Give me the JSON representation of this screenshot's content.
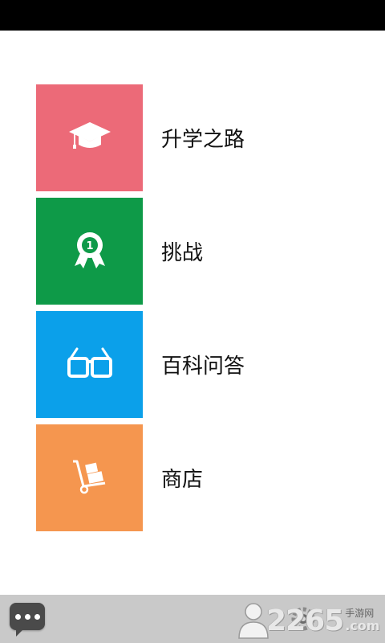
{
  "menu": {
    "items": [
      {
        "label": "升学之路",
        "icon": "graduation-cap-icon",
        "color": "#ec6a78"
      },
      {
        "label": "挑战",
        "icon": "award-badge-icon",
        "color": "#0e9a48",
        "badge_number": "1"
      },
      {
        "label": "百科问答",
        "icon": "glasses-icon",
        "color": "#0ba0ea"
      },
      {
        "label": "商店",
        "icon": "hand-truck-icon",
        "color": "#f5964f"
      }
    ]
  },
  "bottom_bar": {
    "chat_icon": "chat-bubble-icon",
    "avatar_icon": "user-avatar-icon",
    "watermark": {
      "number": "2265",
      "cn": "手游网",
      "domain": ".com"
    }
  },
  "colors": {
    "status_bar": "#000000",
    "bottom_bar": "#c9c9c9"
  }
}
